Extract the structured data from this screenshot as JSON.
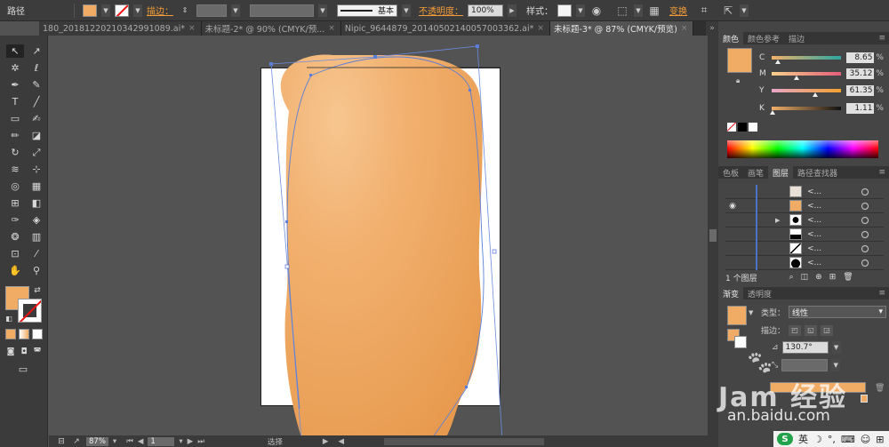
{
  "control_bar": {
    "object_type": "路径",
    "stroke_label": "描边：",
    "stroke_style": "基本",
    "opacity_label": "不透明度：",
    "opacity_value": "100%",
    "style_label": "样式：",
    "transform_label": "变换"
  },
  "tabs": [
    {
      "label": "180_20181220210342991089.ai*",
      "close": "×",
      "active": false
    },
    {
      "label": "未标题-2* @ 90% (CMYK/预...",
      "close": "×",
      "active": false
    },
    {
      "label": "Nipic_9644879_20140502140057003362.ai*",
      "close": "×",
      "active": false
    },
    {
      "label": "未标题-3* @ 87% (CMYK/预览)",
      "close": "×",
      "active": true
    }
  ],
  "tab_overflow": "»",
  "tools": [
    {
      "icon": "selection-tool-icon",
      "glyph": "↖",
      "selected": true
    },
    {
      "icon": "direct-selection-tool-icon",
      "glyph": "↗",
      "selected": false
    },
    {
      "icon": "magic-wand-tool-icon",
      "glyph": "✲",
      "selected": false
    },
    {
      "icon": "lasso-tool-icon",
      "glyph": "ℓ",
      "selected": false
    },
    {
      "icon": "pen-tool-icon",
      "glyph": "✒",
      "selected": false
    },
    {
      "icon": "curvature-tool-icon",
      "glyph": "✎",
      "selected": false
    },
    {
      "icon": "type-tool-icon",
      "glyph": "T",
      "selected": false
    },
    {
      "icon": "line-tool-icon",
      "glyph": "╱",
      "selected": false
    },
    {
      "icon": "rectangle-tool-icon",
      "glyph": "▭",
      "selected": false
    },
    {
      "icon": "paintbrush-tool-icon",
      "glyph": "✍",
      "selected": false
    },
    {
      "icon": "pencil-tool-icon",
      "glyph": "✏",
      "selected": false
    },
    {
      "icon": "eraser-tool-icon",
      "glyph": "◪",
      "selected": false
    },
    {
      "icon": "rotate-tool-icon",
      "glyph": "↻",
      "selected": false
    },
    {
      "icon": "scale-tool-icon",
      "glyph": "⤢",
      "selected": false
    },
    {
      "icon": "warp-tool-icon",
      "glyph": "≋",
      "selected": false
    },
    {
      "icon": "free-transform-tool-icon",
      "glyph": "⊹",
      "selected": false
    },
    {
      "icon": "shape-builder-tool-icon",
      "glyph": "◎",
      "selected": false
    },
    {
      "icon": "perspective-grid-tool-icon",
      "glyph": "▦",
      "selected": false
    },
    {
      "icon": "mesh-tool-icon",
      "glyph": "⊞",
      "selected": false
    },
    {
      "icon": "gradient-tool-icon",
      "glyph": "◧",
      "selected": false
    },
    {
      "icon": "eyedropper-tool-icon",
      "glyph": "✑",
      "selected": false
    },
    {
      "icon": "blend-tool-icon",
      "glyph": "◈",
      "selected": false
    },
    {
      "icon": "symbol-sprayer-tool-icon",
      "glyph": "❂",
      "selected": false
    },
    {
      "icon": "column-graph-tool-icon",
      "glyph": "▥",
      "selected": false
    },
    {
      "icon": "artboard-tool-icon",
      "glyph": "⊡",
      "selected": false
    },
    {
      "icon": "slice-tool-icon",
      "glyph": "⁄",
      "selected": false
    },
    {
      "icon": "hand-tool-icon",
      "glyph": "✋",
      "selected": false
    },
    {
      "icon": "zoom-tool-icon",
      "glyph": "⚲",
      "selected": false
    }
  ],
  "fill_color": "#F0AC64",
  "status_bar": {
    "zoom": "87%",
    "artboard": "1",
    "tool_name": "选择"
  },
  "color_panel": {
    "tabs": [
      "颜色",
      "颜色参考",
      "描边"
    ],
    "c": {
      "label": "C",
      "value": "8.65",
      "unit": "%",
      "fraction": 0.0865
    },
    "m": {
      "label": "M",
      "value": "35.12",
      "unit": "%",
      "fraction": 0.3512
    },
    "y": {
      "label": "Y",
      "value": "61.35",
      "unit": "%",
      "fraction": 0.6135
    },
    "k": {
      "label": "K",
      "value": "1.11",
      "unit": "%",
      "fraction": 0.0111
    }
  },
  "layers_panel": {
    "tabs": [
      "色板",
      "画笔",
      "图层",
      "路径查找器"
    ],
    "active_tab": 2,
    "rows": [
      {
        "name": "<...",
        "visible": false
      },
      {
        "name": "<...",
        "visible": true
      },
      {
        "name": "<...",
        "visible": false
      },
      {
        "name": "<...",
        "visible": false
      },
      {
        "name": "<...",
        "visible": false
      },
      {
        "name": "<...",
        "visible": false
      }
    ],
    "footer": "1 个图层"
  },
  "gradient_panel": {
    "tabs": [
      "渐变",
      "透明度"
    ],
    "type_label": "类型：",
    "type_value": "线性",
    "stroke_label": "描边：",
    "angle": "130.7°"
  },
  "watermark": {
    "big": "Jam 经验",
    "small": "an.baidu.com"
  },
  "ime": {
    "logo": "S",
    "lang": "英"
  }
}
